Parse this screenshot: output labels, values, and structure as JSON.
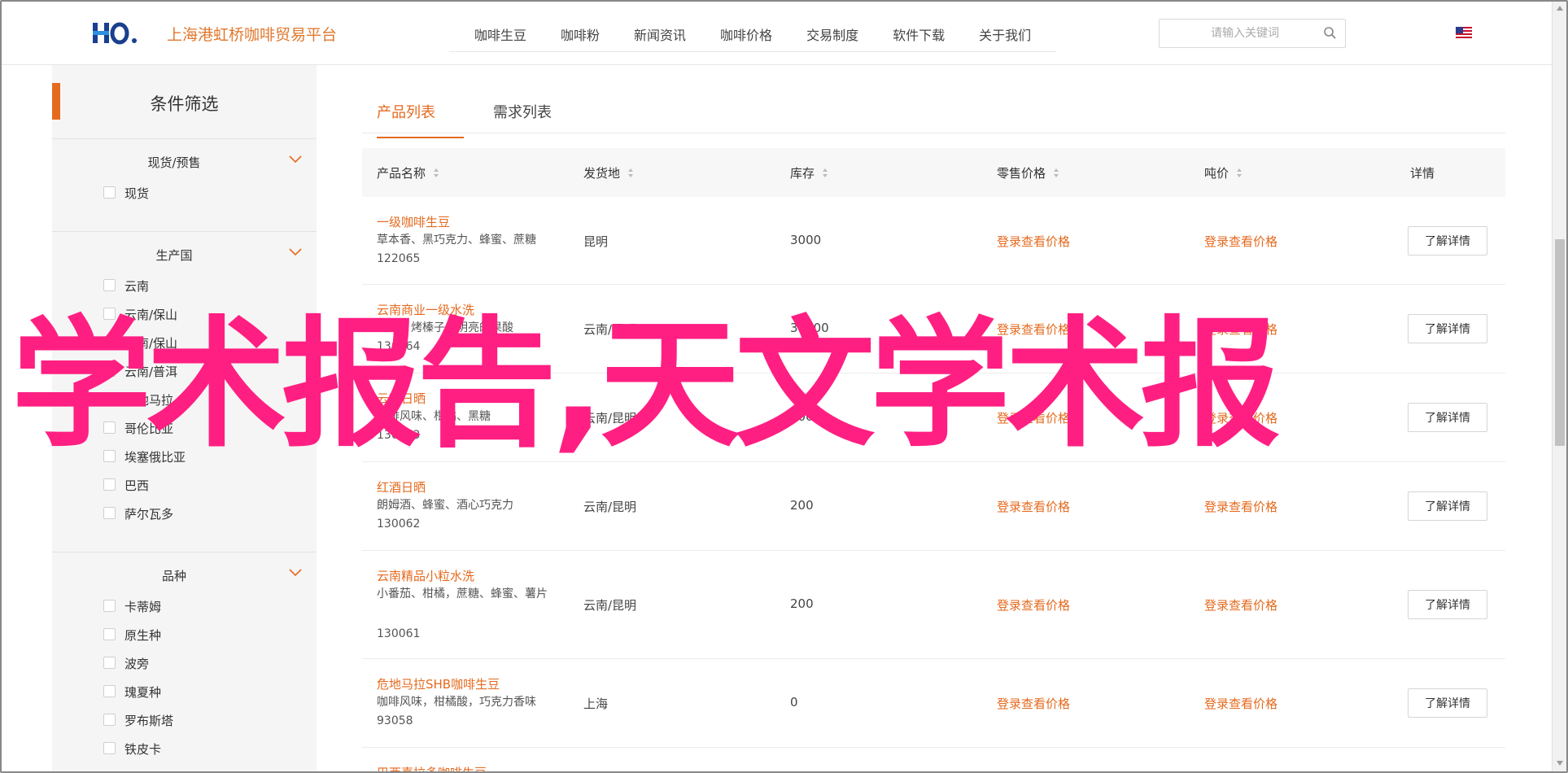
{
  "header": {
    "site_name": "上海港虹桥咖啡贸易平台",
    "nav": [
      "咖啡生豆",
      "咖啡粉",
      "新闻资讯",
      "咖啡价格",
      "交易制度",
      "软件下载",
      "关于我们"
    ],
    "search_placeholder": "请输入关键词"
  },
  "sidebar": {
    "title": "条件筛选",
    "groups": [
      {
        "title": "现货/预售",
        "options": [
          "现货"
        ]
      },
      {
        "title": "生产国",
        "options": [
          "云南",
          "云南/保山",
          "云南/保山",
          "云南/普洱",
          "危地马拉",
          "哥伦比亚",
          "埃塞俄比亚",
          "巴西",
          "萨尔瓦多"
        ]
      },
      {
        "title": "品种",
        "options": [
          "卡蒂姆",
          "原生种",
          "波旁",
          "瑰夏种",
          "罗布斯塔",
          "铁皮卡"
        ]
      }
    ]
  },
  "tabs": {
    "products": "产品列表",
    "demands": "需求列表"
  },
  "table": {
    "headers": {
      "name": "产品名称",
      "origin": "发货地",
      "stock": "库存",
      "retail": "零售价格",
      "ton": "吨价",
      "detail": "详情"
    },
    "rows": [
      {
        "name": "一级咖啡生豆",
        "desc": "草本香、黑巧克力、蜂蜜、蔗糖",
        "code": "122065",
        "origin": "昆明",
        "stock": "3000",
        "retail": "登录查看价格",
        "ton": "登录查看价格",
        "action": "了解详情"
      },
      {
        "name": "云南商业一级水洗",
        "desc": "焦糖、烤榛子，明亮的果酸",
        "code": "130064",
        "origin": "云南/昆明",
        "stock": "30000",
        "retail": "登录查看价格",
        "ton": "登录查看价格",
        "action": "了解详情"
      },
      {
        "name": "云南日晒",
        "desc": "咖啡风味、柑橘、黑糖",
        "code": "130063",
        "origin": "云南/昆明",
        "stock": "200",
        "retail": "登录查看价格",
        "ton": "登录查看价格",
        "action": "了解详情"
      },
      {
        "name": "红酒日晒",
        "desc": "朗姆酒、蜂蜜、酒心巧克力",
        "code": "130062",
        "origin": "云南/昆明",
        "stock": "200",
        "retail": "登录查看价格",
        "ton": "登录查看价格",
        "action": "了解详情"
      },
      {
        "name": "云南精品小粒水洗",
        "desc": "小番茄、柑橘，蔗糖、蜂蜜、薯片",
        "code": "130061",
        "origin": "云南/昆明",
        "stock": "200",
        "retail": "登录查看价格",
        "ton": "登录查看价格",
        "action": "了解详情"
      },
      {
        "name": "危地马拉SHB咖啡生豆",
        "desc": "咖啡风味，柑橘酸，巧克力香味",
        "code": "93058",
        "origin": "上海",
        "stock": "0",
        "retail": "登录查看价格",
        "ton": "登录查看价格",
        "action": "了解详情"
      },
      {
        "name": "巴西喜拉多咖啡生豆",
        "desc": "",
        "code": "",
        "origin": "",
        "stock": "",
        "retail": "",
        "ton": "",
        "action": ""
      }
    ]
  },
  "overlay_text": "学术报告,天文学术报"
}
